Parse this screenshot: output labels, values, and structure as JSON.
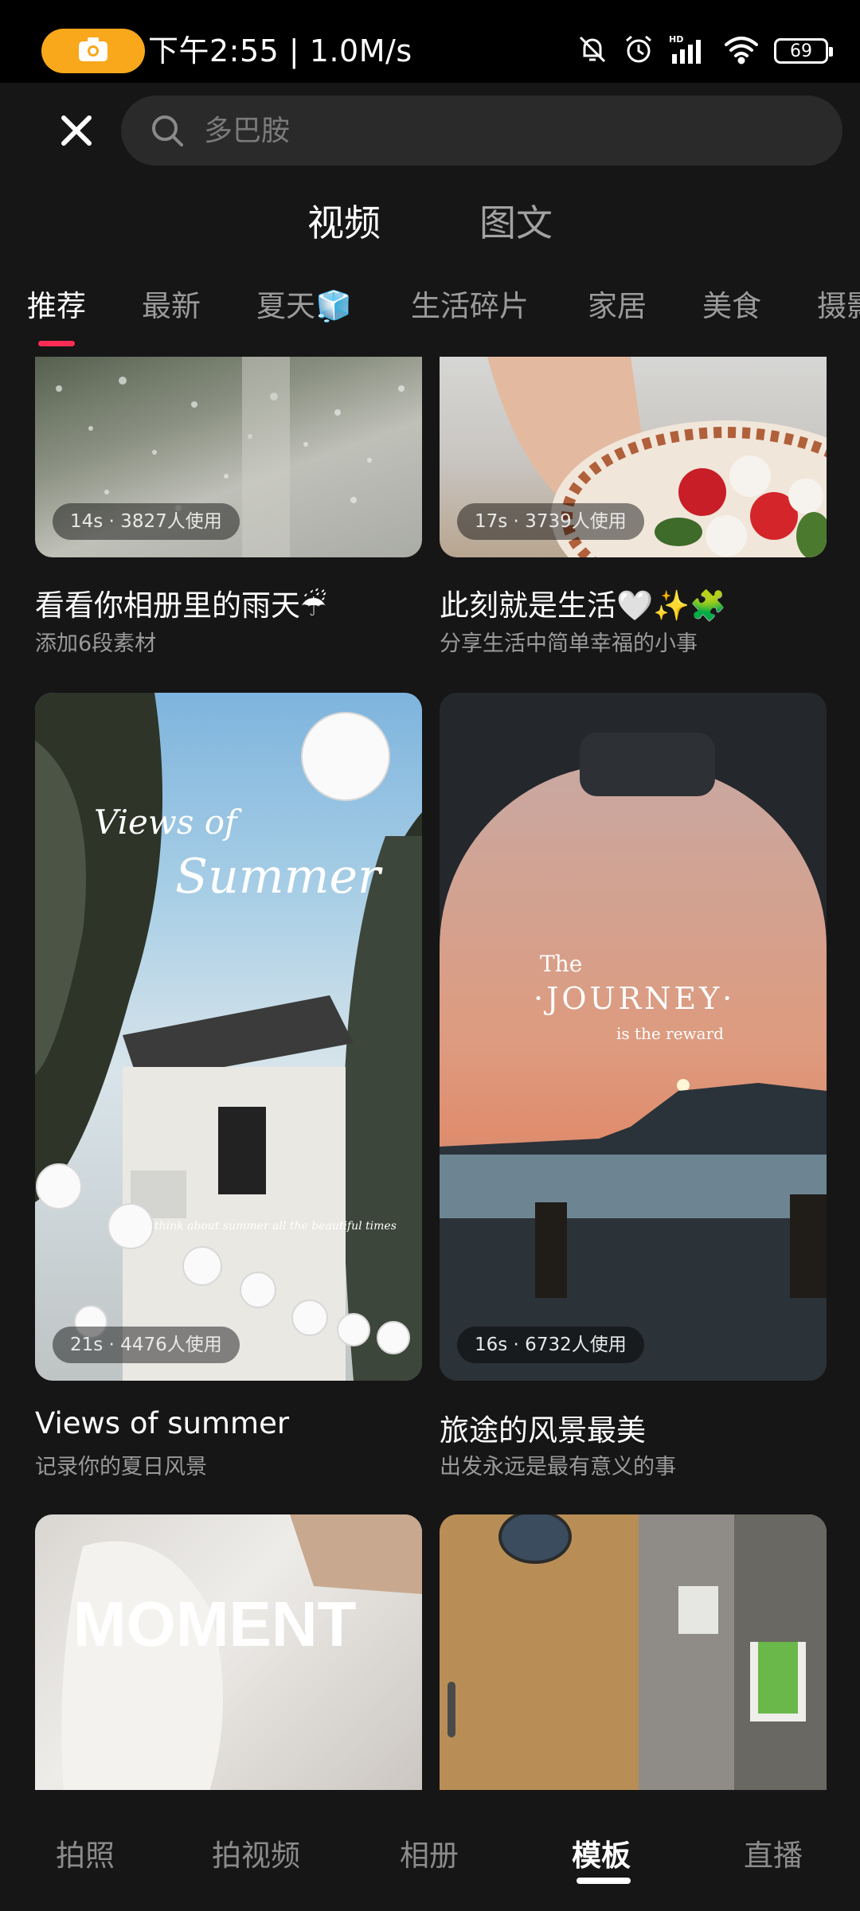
{
  "status_bar": {
    "time_speed": "下午2:55 | 1.0M/s",
    "battery": "69",
    "icons": [
      "camera-recording-icon",
      "bell-muted-icon",
      "alarm-icon",
      "hd-signal-icon",
      "wifi-icon",
      "battery-icon"
    ],
    "recording_color": "#f9a71b"
  },
  "search": {
    "placeholder": "多巴胺",
    "value": ""
  },
  "main_tabs": [
    {
      "label": "视频",
      "active": true
    },
    {
      "label": "图文",
      "active": false
    }
  ],
  "categories": [
    {
      "label": "推荐",
      "active": true
    },
    {
      "label": "最新"
    },
    {
      "label": "夏天🧊"
    },
    {
      "label": "生活碎片"
    },
    {
      "label": "家居"
    },
    {
      "label": "美食"
    },
    {
      "label": "摄影"
    }
  ],
  "accent_color": "#fe2c55",
  "cards": [
    {
      "meta": "14s · 3827人使用",
      "title": "看看你相册里的雨天☔",
      "subtitle": "添加6段素材"
    },
    {
      "meta": "17s · 3739人使用",
      "title": "此刻就是生活🤍✨🧩",
      "subtitle": "分享生活中简单幸福的小事"
    },
    {
      "meta": "21s · 4476人使用",
      "title": "Views of summer",
      "subtitle": "记录你的夏日风景",
      "overlay_line1": "Views of",
      "overlay_line2": "Summer",
      "overlay_small": "think about summer all the beautiful times"
    },
    {
      "meta": "16s · 6732人使用",
      "title": "旅途的风景最美",
      "subtitle": "出发永远是最有意义的事",
      "overlay_line1": "The",
      "overlay_line2": "·JOURNEY·",
      "overlay_line3": "is the reward"
    },
    {
      "overlay_line1": "MOMENT"
    },
    {}
  ],
  "bottom_nav": [
    {
      "label": "拍照"
    },
    {
      "label": "拍视频"
    },
    {
      "label": "相册"
    },
    {
      "label": "模板",
      "active": true
    },
    {
      "label": "直播"
    }
  ]
}
